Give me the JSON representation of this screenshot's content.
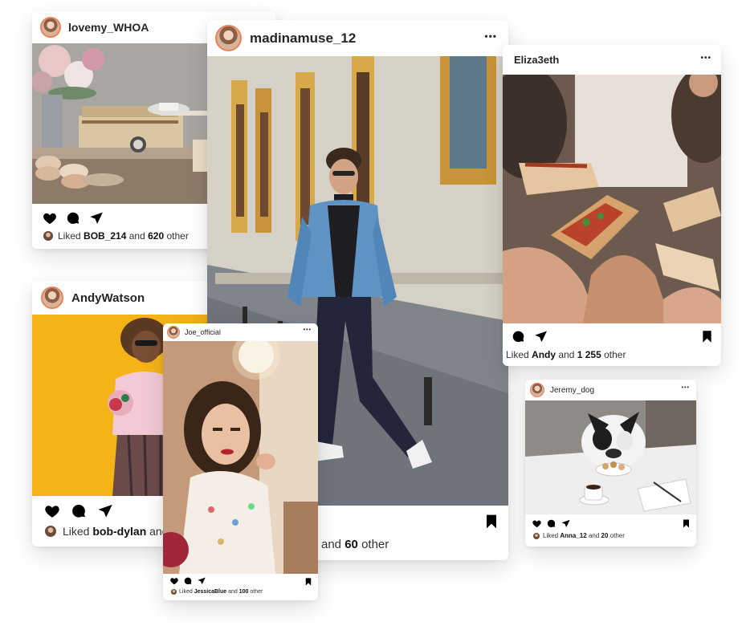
{
  "posts": {
    "lovemy": {
      "username": "lovemy_WHOA",
      "liked_prefix": "Liked",
      "liked_user": "BOB_214",
      "liked_and": "and",
      "liked_count": "620",
      "liked_suffix": "other"
    },
    "madina": {
      "username": "madinamuse_12",
      "liked_and": "and",
      "liked_count": "60",
      "liked_suffix": "other"
    },
    "eliza": {
      "username": "Eliza3eth",
      "liked_prefix": "Liked",
      "liked_user": "Andy",
      "liked_and": "and",
      "liked_count": "1 255",
      "liked_suffix": "other"
    },
    "andy": {
      "username": "AndyWatson",
      "liked_prefix": "Liked",
      "liked_user": "bob-dylan",
      "liked_and": "and"
    },
    "joe": {
      "username": "Joe_official",
      "liked_prefix": "Liked",
      "liked_user": "JessicaBlue",
      "liked_and": "and",
      "liked_count": "100",
      "liked_suffix": "other"
    },
    "jeremy": {
      "username": "Jeremy_dog",
      "liked_prefix": "Liked",
      "liked_user": "Anna_12",
      "liked_and": "and",
      "liked_count": "20",
      "liked_suffix": "other"
    }
  },
  "menu_glyph": "•••",
  "icons": [
    "heart-icon",
    "comment-icon",
    "share-icon",
    "bookmark-icon",
    "more-icon"
  ],
  "colors": {
    "avatar_ring": "#e9835a",
    "yellow_backdrop": "#f4b418",
    "card_bg": "#ffffff",
    "text": "#262626"
  }
}
